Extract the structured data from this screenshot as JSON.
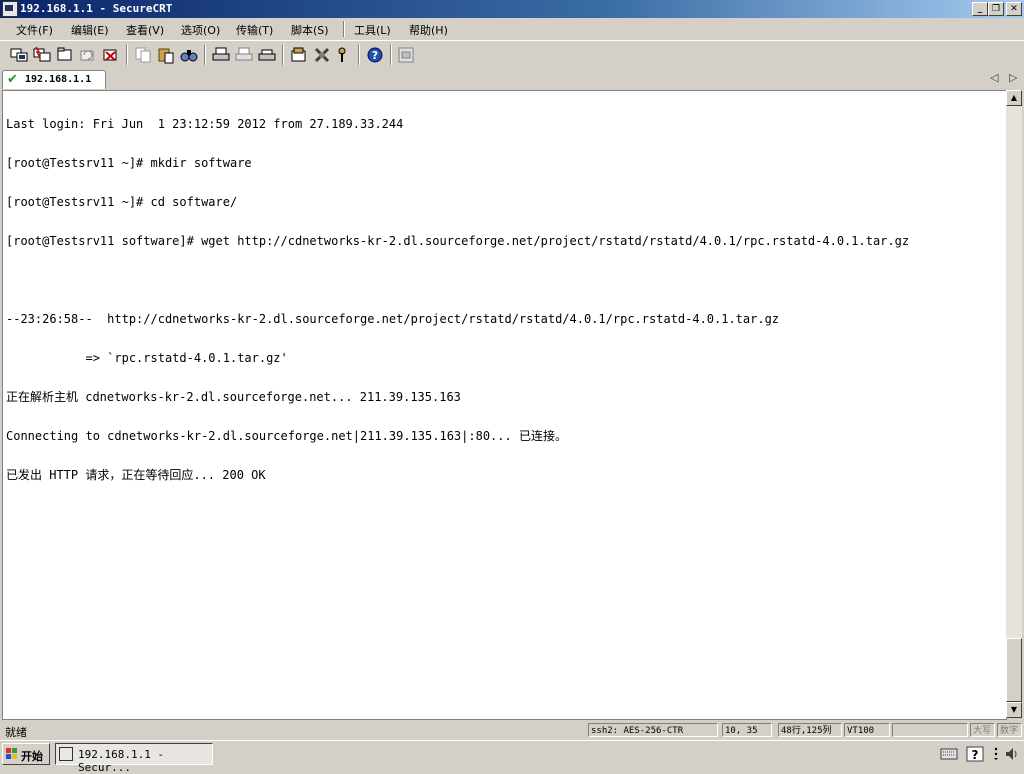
{
  "window": {
    "title": "192.168.1.1 - SecureCRT"
  },
  "window_controls": {
    "minimize": "_",
    "restore": "❐",
    "close": "✕"
  },
  "menu": [
    {
      "label": "文件(F)"
    },
    {
      "label": "编辑(E)"
    },
    {
      "label": "查看(V)"
    },
    {
      "label": "选项(O)"
    },
    {
      "label": "传输(T)"
    },
    {
      "label": "脚本(S)"
    },
    {
      "label": "工具(L)"
    },
    {
      "label": "帮助(H)"
    }
  ],
  "toolbar": {
    "icons": [
      "connect-icon",
      "quick-connect-icon",
      "connect-in-tab-icon",
      "reconnect-icon",
      "disconnect-icon",
      "copy-icon",
      "paste-icon",
      "find-icon",
      "print-icon",
      "print-selection-icon",
      "print-setup-icon",
      "session-options-icon",
      "global-options-icon",
      "keymap-icon",
      "help-icon",
      "log-icon"
    ]
  },
  "tabs": [
    {
      "label": "192.168.1.1",
      "status": "connected"
    }
  ],
  "terminal": {
    "lines": [
      "Last login: Fri Jun  1 23:12:59 2012 from 27.189.33.244",
      "[root@Testsrv11 ~]# mkdir software",
      "[root@Testsrv11 ~]# cd software/",
      "[root@Testsrv11 software]# wget http://cdnetworks-kr-2.dl.sourceforge.net/project/rstatd/rstatd/4.0.1/rpc.rstatd-4.0.1.tar.gz",
      "",
      "--23:26:58--  http://cdnetworks-kr-2.dl.sourceforge.net/project/rstatd/rstatd/4.0.1/rpc.rstatd-4.0.1.tar.gz",
      "           => `rpc.rstatd-4.0.1.tar.gz'",
      "正在解析主机 cdnetworks-kr-2.dl.sourceforge.net... 211.39.135.163",
      "Connecting to cdnetworks-kr-2.dl.sourceforge.net|211.39.135.163|:80... 已连接。",
      "已发出 HTTP 请求，正在等待回应... 200 OK"
    ]
  },
  "status": {
    "ready": "就绪",
    "cipher": "ssh2: AES-256-CTR",
    "cursor": "10,  35",
    "size": "48行,125列",
    "emulation": "VT100",
    "empty": "",
    "caps": "大写",
    "num": "数字"
  },
  "taskbar": {
    "start_label": "开始",
    "task_label": "192.168.1.1 - Secur..."
  }
}
